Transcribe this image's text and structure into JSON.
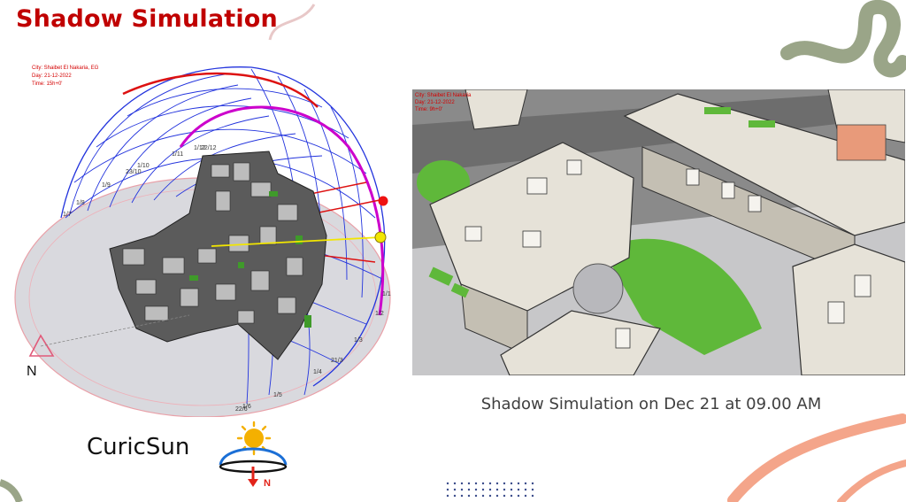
{
  "slide": {
    "title": "Shadow Simulation",
    "caption": "Shadow Simulation on Dec 21 at 09.00 AM",
    "logo_label": "CuricSun",
    "logo_letter": "N"
  },
  "left_figure": {
    "info_lines": [
      "City: Shaibet El Nakaria, EG",
      "Day: 21-12-2022",
      "Time: 15h+0'"
    ],
    "north_label": "N",
    "date_ticks": [
      "1/7",
      "1/8",
      "1/9",
      "1/10",
      "23/10",
      "1/11",
      "1/12",
      "22/12",
      "1/1",
      "1/2",
      "1/3",
      "21/3",
      "1/4",
      "1/5",
      "22/6",
      "1/6"
    ]
  },
  "right_figure": {
    "info_lines": [
      "City: Shaibet El Nakaria",
      "Day: 21-12-2022",
      "Time: 9h+0'"
    ]
  },
  "colors": {
    "title": "#c00000",
    "accent_green": "#9aa588",
    "accent_salmon": "#f4a58a",
    "sky_grid": "#2233dd",
    "sun_path": "#cc00cc",
    "green_area": "#5fb83a"
  }
}
